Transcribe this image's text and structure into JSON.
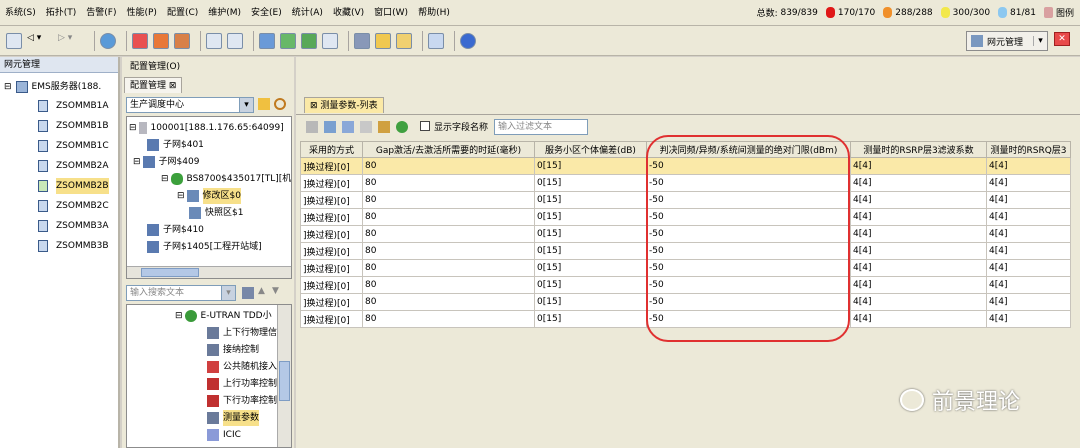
{
  "menu": [
    "系统(S)",
    "拓扑(T)",
    "告警(F)",
    "性能(P)",
    "配置(C)",
    "维护(M)",
    "安全(E)",
    "统计(A)",
    "收藏(V)",
    "窗口(W)",
    "帮助(H)"
  ],
  "alarm_stats": {
    "total_label": "总数:",
    "total": "839/839",
    "critical": "170/170",
    "major": "288/288",
    "minor": "300/300",
    "warning": "81/81",
    "legend_label": "图例",
    "colors": {
      "critical": "#e01818",
      "major": "#f0902a",
      "minor": "#f2e84a",
      "warning": "#8cc8f0"
    }
  },
  "toolbar_right": {
    "net_mgr": "网元管理"
  },
  "left_panel": {
    "tab": "网元管理",
    "root": "EMS服务器(188.",
    "items": [
      "ZSOMMB1A",
      "ZSOMMB1B",
      "ZSOMMB1C",
      "ZSOMMB2A",
      "ZSOMMB2B",
      "ZSOMMB2C",
      "ZSOMMB3A",
      "ZSOMMB3B"
    ],
    "selected_index": 4
  },
  "mid_panel": {
    "breadcrumb": "配置管理(O)",
    "tab": "配置管理",
    "combo_value": "生产调度中心",
    "tree": {
      "root": "100001[188.1.176.65:64099]",
      "n1": "子网$401",
      "n2": "子网$409",
      "n3": "BS8700$435017[TL][机",
      "n4": "修改区$0",
      "n5": "快照区$1",
      "n6": "子网$410",
      "n7": "子网$1405[工程开站域]"
    },
    "search_placeholder": "输入搜索文本",
    "mo_tree": {
      "root": "E-UTRAN TDD小",
      "items": [
        "上下行物理信",
        "接纳控制",
        "公共随机接入",
        "上行功率控制",
        "下行功率控制",
        "测量参数",
        "ICIC"
      ]
    }
  },
  "right_panel": {
    "tab": "测量参数-列表",
    "checkbox_label": "显示字段名称",
    "filter_placeholder": "输入过滤文本",
    "columns": [
      "采用的方式",
      "Gap激活/去激活所需要的时延(毫秒)",
      "服务小区个体偏差(dB)",
      "判决同频/异频/系统间测量的绝对门限(dBm)",
      "测量时的RSRP层3滤波系数",
      "测量时的RSRQ层3"
    ],
    "rows": [
      [
        "]换过程)[0]",
        "80",
        "0[15]",
        "-50",
        "4[4]",
        "4[4]"
      ],
      [
        "]换过程)[0]",
        "80",
        "0[15]",
        "-50",
        "4[4]",
        "4[4]"
      ],
      [
        "]换过程)[0]",
        "80",
        "0[15]",
        "-50",
        "4[4]",
        "4[4]"
      ],
      [
        "]换过程)[0]",
        "80",
        "0[15]",
        "-50",
        "4[4]",
        "4[4]"
      ],
      [
        "]换过程)[0]",
        "80",
        "0[15]",
        "-50",
        "4[4]",
        "4[4]"
      ],
      [
        "]换过程)[0]",
        "80",
        "0[15]",
        "-50",
        "4[4]",
        "4[4]"
      ],
      [
        "]换过程)[0]",
        "80",
        "0[15]",
        "-50",
        "4[4]",
        "4[4]"
      ],
      [
        "]换过程)[0]",
        "80",
        "0[15]",
        "-50",
        "4[4]",
        "4[4]"
      ],
      [
        "]换过程)[0]",
        "80",
        "0[15]",
        "-50",
        "4[4]",
        "4[4]"
      ],
      [
        "]换过程)[0]",
        "80",
        "0[15]",
        "-50",
        "4[4]",
        "4[4]"
      ]
    ],
    "highlight_row": 0
  },
  "watermark": "前景理论"
}
